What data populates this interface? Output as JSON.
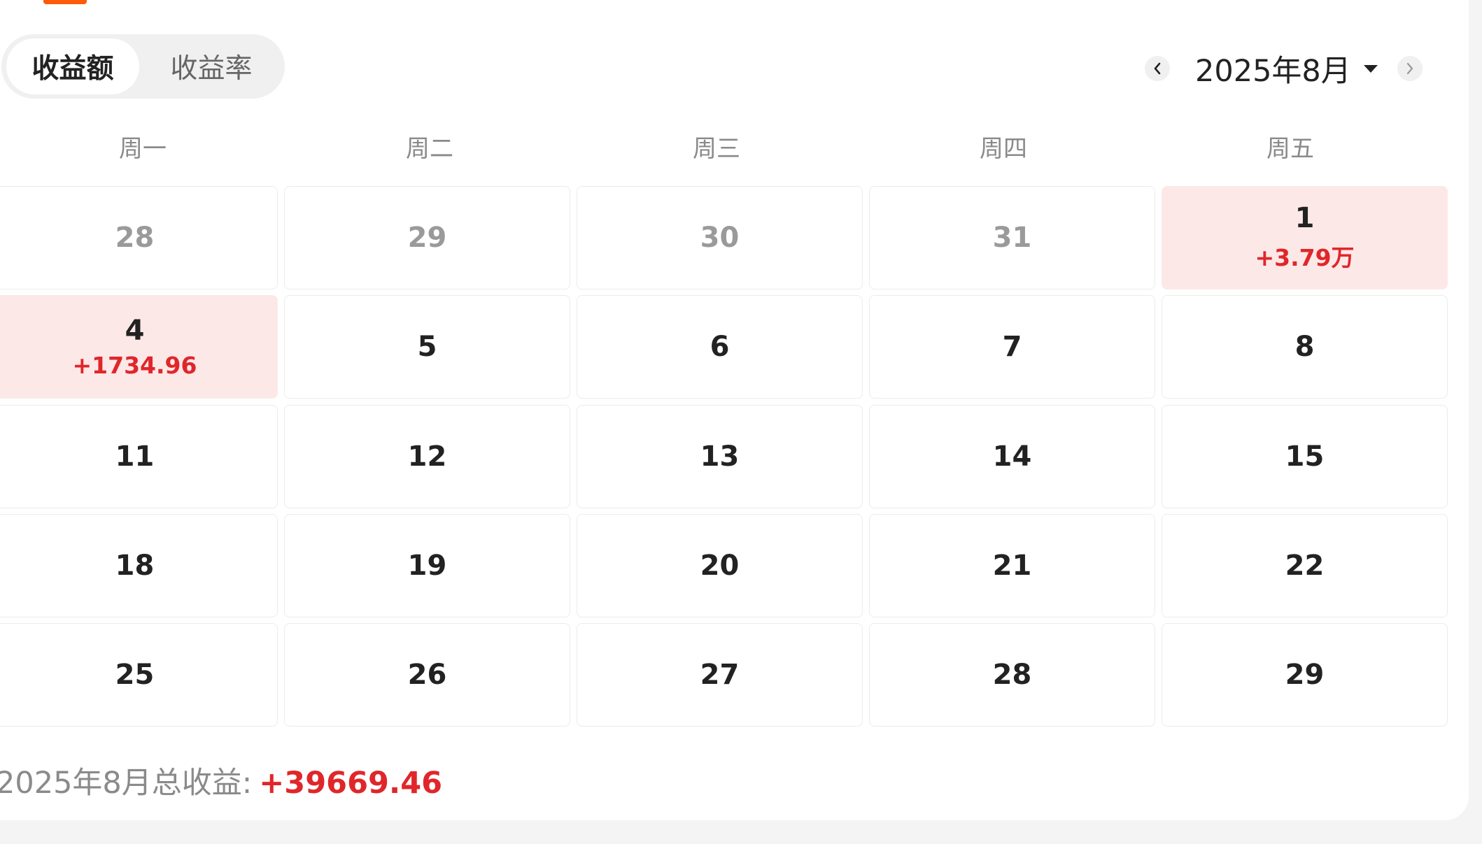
{
  "tabs": {
    "items": [
      {
        "label": "收益额",
        "active": true
      },
      {
        "label": "收益率",
        "active": false
      }
    ]
  },
  "month_nav": {
    "label": "2025年8月",
    "prev_icon": "chevron-left-icon",
    "next_icon": "chevron-right-icon",
    "dropdown_icon": "caret-down-icon"
  },
  "weekdays": [
    "周一",
    "周二",
    "周三",
    "周四",
    "周五"
  ],
  "calendar": {
    "weeks": [
      [
        {
          "day": "28",
          "other_month": true
        },
        {
          "day": "29",
          "other_month": true
        },
        {
          "day": "30",
          "other_month": true
        },
        {
          "day": "31",
          "other_month": true
        },
        {
          "day": "1",
          "gain": "+3.79万"
        }
      ],
      [
        {
          "day": "4",
          "gain": "+1734.96"
        },
        {
          "day": "5"
        },
        {
          "day": "6"
        },
        {
          "day": "7"
        },
        {
          "day": "8"
        }
      ],
      [
        {
          "day": "11"
        },
        {
          "day": "12"
        },
        {
          "day": "13"
        },
        {
          "day": "14"
        },
        {
          "day": "15"
        }
      ],
      [
        {
          "day": "18"
        },
        {
          "day": "19"
        },
        {
          "day": "20"
        },
        {
          "day": "21"
        },
        {
          "day": "22"
        }
      ],
      [
        {
          "day": "25"
        },
        {
          "day": "26"
        },
        {
          "day": "27"
        },
        {
          "day": "28"
        },
        {
          "day": "29"
        }
      ]
    ]
  },
  "summary": {
    "label": "2025年8月总收益:",
    "value": "+39669.46"
  },
  "colors": {
    "accent": "#ff5a0a",
    "profit_text": "#e0262a",
    "profit_bg": "#fde8e8"
  }
}
